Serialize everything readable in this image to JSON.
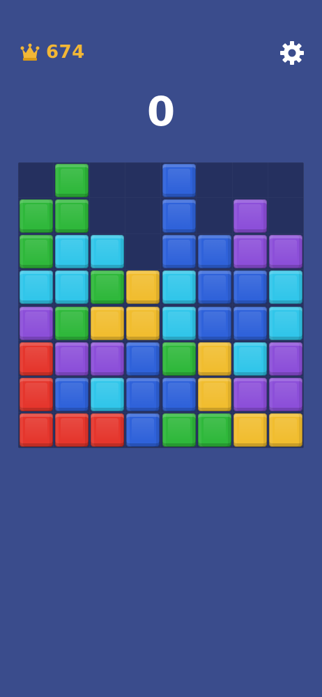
{
  "header": {
    "best_score": "674",
    "current_score": "0"
  },
  "icons": {
    "crown": "crown-icon",
    "settings": "gear-icon"
  },
  "colors": {
    "background": "#3a4c8c",
    "board_background": "#25305f",
    "best_score": "#f2b736",
    "current_score": "#ffffff",
    "tile": {
      "green": "#2fb83b",
      "cyan": "#31c6ea",
      "blue": "#2f62da",
      "purple": "#8c4fd9",
      "yellow": "#f1bd2f",
      "red": "#e5362d"
    }
  },
  "board": {
    "rows": 8,
    "cols": 8,
    "grid": [
      [
        null,
        "green",
        null,
        null,
        "blue",
        null,
        null,
        null
      ],
      [
        "green",
        "green",
        null,
        null,
        "blue",
        null,
        "purple",
        null
      ],
      [
        "green",
        "cyan",
        "cyan",
        null,
        "blue",
        "blue",
        "purple",
        "purple"
      ],
      [
        "cyan",
        "cyan",
        "green",
        "yellow",
        "cyan",
        "blue",
        "blue",
        "cyan"
      ],
      [
        "purple",
        "green",
        "yellow",
        "yellow",
        "cyan",
        "blue",
        "blue",
        "cyan"
      ],
      [
        "red",
        "purple",
        "purple",
        "blue",
        "green",
        "yellow",
        "cyan",
        "purple"
      ],
      [
        "red",
        "blue",
        "cyan",
        "blue",
        "blue",
        "yellow",
        "purple",
        "purple"
      ],
      [
        "red",
        "red",
        "red",
        "blue",
        "green",
        "green",
        "yellow",
        "yellow"
      ]
    ]
  }
}
